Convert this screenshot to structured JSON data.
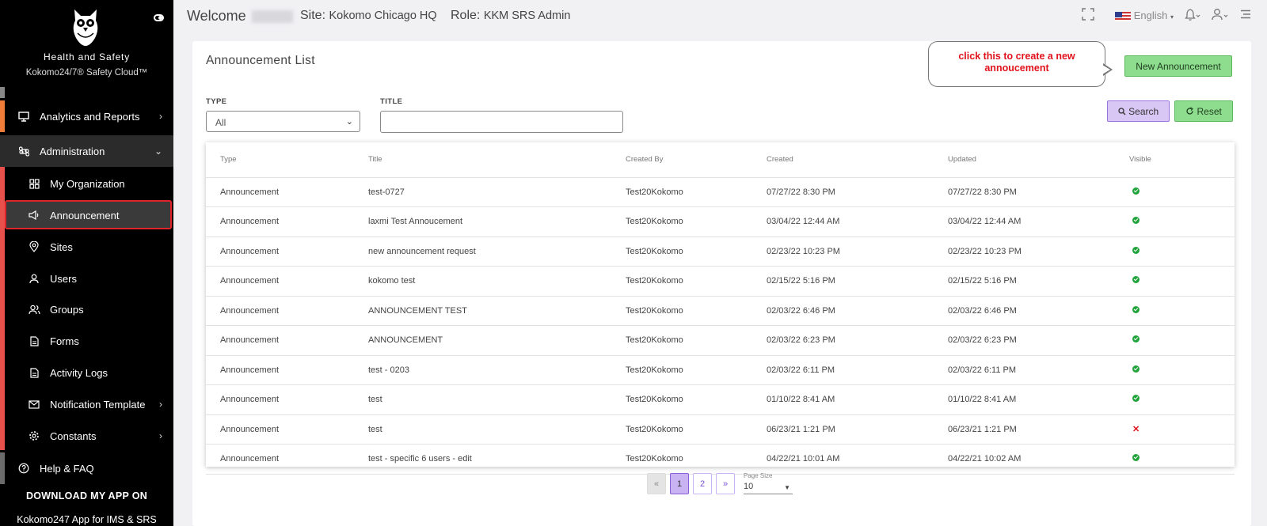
{
  "sidebar": {
    "brand_title": "Health and Safety",
    "brand_sub": "Kokomo24/7® Safety Cloud™",
    "items": [
      {
        "label": "Analytics and Reports",
        "icon": "monitor-icon"
      },
      {
        "label": "Administration",
        "icon": "command-icon"
      },
      {
        "label": "My Organization",
        "icon": "grid-icon"
      },
      {
        "label": "Announcement",
        "icon": "megaphone-icon"
      },
      {
        "label": "Sites",
        "icon": "map-pin-icon"
      },
      {
        "label": "Users",
        "icon": "user-icon"
      },
      {
        "label": "Groups",
        "icon": "users-icon"
      },
      {
        "label": "Forms",
        "icon": "document-icon"
      },
      {
        "label": "Activity Logs",
        "icon": "document-icon"
      },
      {
        "label": "Notification Template",
        "icon": "mail-icon"
      },
      {
        "label": "Constants",
        "icon": "gear-icon"
      },
      {
        "label": "Help & FAQ",
        "icon": "help-icon"
      }
    ],
    "download": "DOWNLOAD MY APP ON",
    "app_text": "Kokomo247 App for IMS & SRS"
  },
  "header": {
    "welcome": "Welcome",
    "site_label": "Site:",
    "site_value": "Kokomo Chicago HQ",
    "role_label": "Role:",
    "role_value": "KKM SRS Admin",
    "language": "English"
  },
  "page": {
    "title": "Announcement List",
    "callout": "click this to create a new annoucement",
    "new_button": "New Announcement",
    "type_label": "TYPE",
    "type_value": "All",
    "title_label": "TITLE",
    "title_value": "",
    "search_button": "Search",
    "reset_button": "Reset"
  },
  "table": {
    "headers": [
      "Type",
      "Title",
      "Created By",
      "Created",
      "Updated",
      "Visible"
    ],
    "rows": [
      {
        "type": "Announcement",
        "title": "test-0727",
        "by": "Test20Kokomo",
        "created": "07/27/22 8:30 PM",
        "updated": "07/27/22 8:30 PM",
        "visible": true
      },
      {
        "type": "Announcement",
        "title": "laxmi Test Annoucement",
        "by": "Test20Kokomo",
        "created": "03/04/22 12:44 AM",
        "updated": "03/04/22 12:44 AM",
        "visible": true
      },
      {
        "type": "Announcement",
        "title": "new announcement request",
        "by": "Test20Kokomo",
        "created": "02/23/22 10:23 PM",
        "updated": "02/23/22 10:23 PM",
        "visible": true
      },
      {
        "type": "Announcement",
        "title": "kokomo test",
        "by": "Test20Kokomo",
        "created": "02/15/22 5:16 PM",
        "updated": "02/15/22 5:16 PM",
        "visible": true
      },
      {
        "type": "Announcement",
        "title": "ANNOUNCEMENT TEST",
        "by": "Test20Kokomo",
        "created": "02/03/22 6:46 PM",
        "updated": "02/03/22 6:46 PM",
        "visible": true
      },
      {
        "type": "Announcement",
        "title": "ANNOUNCEMENT",
        "by": "Test20Kokomo",
        "created": "02/03/22 6:23 PM",
        "updated": "02/03/22 6:23 PM",
        "visible": true
      },
      {
        "type": "Announcement",
        "title": "test - 0203",
        "by": "Test20Kokomo",
        "created": "02/03/22 6:11 PM",
        "updated": "02/03/22 6:11 PM",
        "visible": true
      },
      {
        "type": "Announcement",
        "title": "test",
        "by": "Test20Kokomo",
        "created": "01/10/22 8:41 AM",
        "updated": "01/10/22 8:41 AM",
        "visible": true
      },
      {
        "type": "Announcement",
        "title": "test",
        "by": "Test20Kokomo",
        "created": "06/23/21 1:21 PM",
        "updated": "06/23/21 1:21 PM",
        "visible": false
      },
      {
        "type": "Announcement",
        "title": "test - specific 6 users - edit",
        "by": "Test20Kokomo",
        "created": "04/22/21 10:01 AM",
        "updated": "04/22/21 10:02 AM",
        "visible": true
      }
    ]
  },
  "pagination": {
    "prev": "«",
    "pages": [
      "1",
      "2"
    ],
    "next": "»",
    "page_size_label": "Page Size",
    "page_size": "10"
  }
}
